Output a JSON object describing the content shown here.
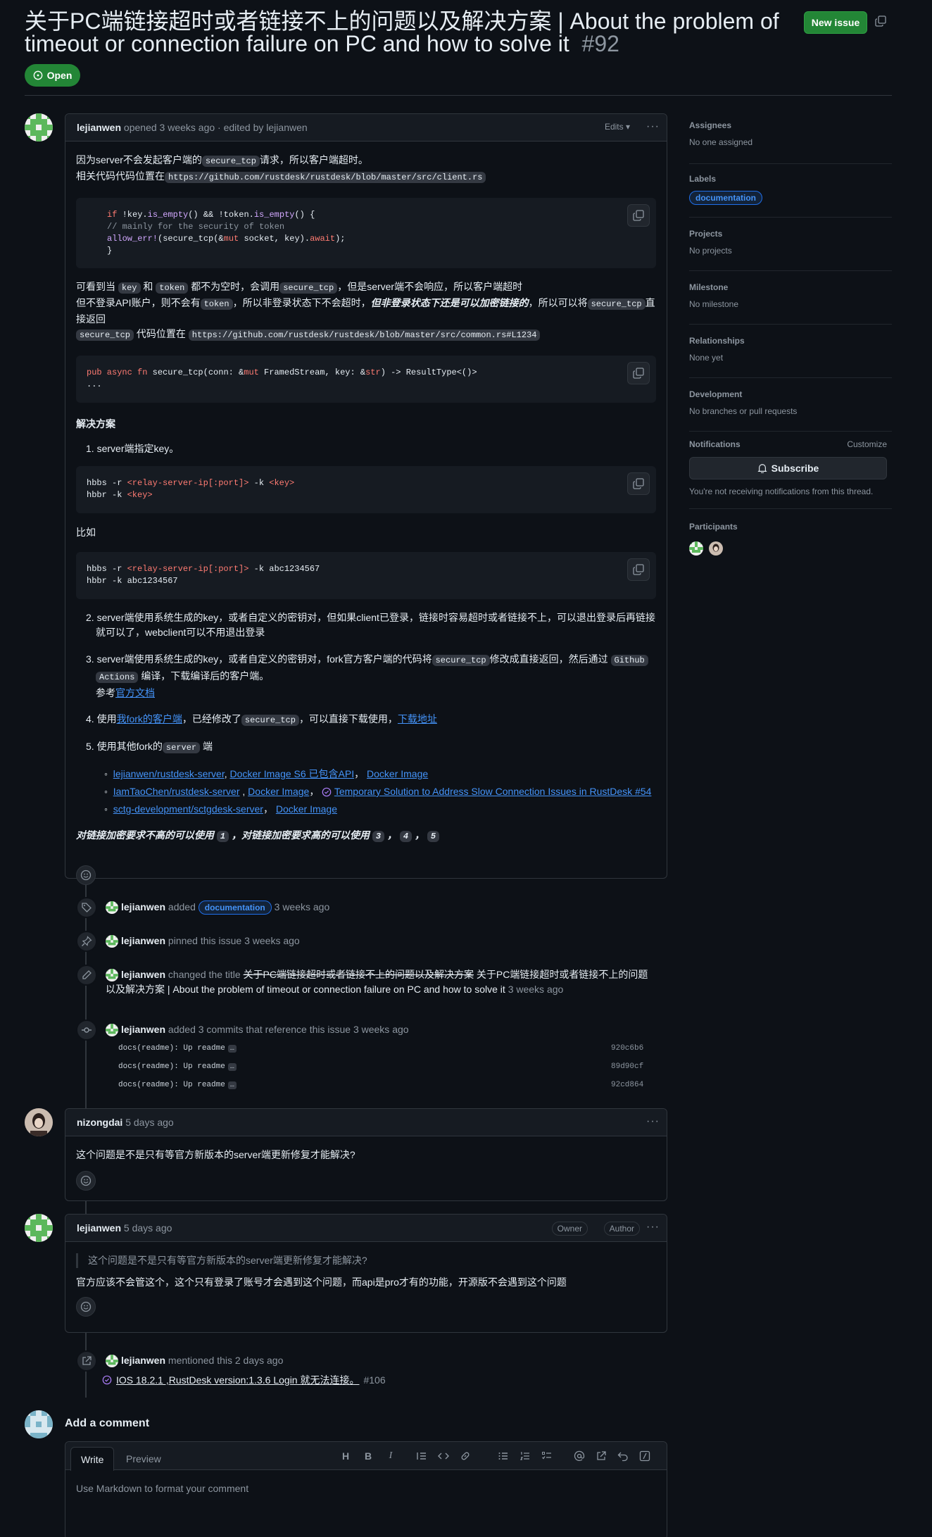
{
  "issue": {
    "title": "关于PC端链接超时或者链接不上的问题以及解决方案 | About the problem of timeout or connection failure on PC and how to solve it",
    "number": "#92",
    "new_issue_label": "New issue",
    "state": "Open"
  },
  "op": {
    "author": "lejianwen",
    "meta": "opened 3 weeks ago · edited by lejianwen",
    "edits_label": "Edits",
    "line1": "因为server不会发起客户端的",
    "line1_code": "secure_tcp",
    "line1_tail": "请求，所以客户端超时。",
    "line2": "相关代码代码位置在",
    "line2_code": "https://github.com/rustdesk/rustdesk/blob/master/src/client.rs",
    "code1": [
      "if !key.is_empty() && !token.is_empty() {",
      "// mainly for the security of token",
      "allow_err!(secure_tcp(&mut socket, key).await);",
      "}"
    ],
    "p2_a": "可看到当",
    "p2_key": "key",
    "p2_and": "和",
    "p2_token": "token",
    "p2_b": "都不为空时，会调用",
    "p2_secure": "secure_tcp",
    "p2_c": "，但是server端不会响应，所以客户端超时",
    "p3_a": "但不登录API账户，则不会有",
    "p3_token": "token",
    "p3_b": "，所以非登录状态下不会超时，",
    "p3_em": "但非登录状态下还是可以加密链接的",
    "p3_c": "，所以可以将",
    "p3_code": "secure_tcp",
    "p3_d": "直接返回",
    "p4_code": "secure_tcp",
    "p4_a": "代码位置在",
    "p4_url": "https://github.com/rustdesk/rustdesk/blob/master/src/common.rs#L1234",
    "code2": [
      "pub async fn secure_tcp(conn: &mut FramedStream, key: &str) -> ResultType<()>",
      "..."
    ],
    "solution_heading": "解决方案",
    "item1": "server端指定key。",
    "code3": [
      "hbbs -r <relay-server-ip[:port]> -k <key>",
      "hbbr -k <key>"
    ],
    "example_label": "比如",
    "code4": [
      "hbbs -r <relay-server-ip[:port]> -k abc1234567",
      "hbbr -k abc1234567"
    ],
    "item2_l1": "server端使用系统生成的key，或者自定义的密钥对，但如果client已登录，链接时容易超时或者链接不上，可以退出登录后再链接",
    "item2_l2": "就可以了，webclient可以不用退出登录",
    "item3_a": "server端使用系统生成的key，或者自定义的密钥对，fork官方客户端的代码将",
    "item3_code": "secure_tcp",
    "item3_b": "修改成直接返回，然后通过",
    "item3_code2": "Github",
    "item3_code3": "Actions",
    "item3_c": "编译，下载编译后的客户端。",
    "item3_ref": "参考",
    "item3_link": "官方文档",
    "item4_a": "使用",
    "item4_link": "我fork的客户端",
    "item4_b": "，已经修改了",
    "item4_code": "secure_tcp",
    "item4_c": "，可以直接下载使用，",
    "item4_link2": "下载地址",
    "item5_a": "使用其他fork的",
    "item5_code": "server",
    "item5_b": "端",
    "sub1_a": "lejianwen/rustdesk-server",
    "sub1_b": "Docker Image S6 已包含API",
    "sub1_c": "Docker Image",
    "sub2_a": "IamTaoChen/rustdesk-server",
    "sub2_b": "Docker Image",
    "sub2_c": "Temporary Solution to Address Slow Connection Issues in RustDesk #54",
    "sub3_a": "sctg-development/sctgdesk-server",
    "sub3_b": "Docker Image",
    "final_a": "对链接加密要求不高的可以使用",
    "final_1": "1",
    "final_b": "，对链接加密要求高的可以使用",
    "final_3": "3",
    "final_4": "4",
    "final_5": "5",
    "sep": "，"
  },
  "events": [
    {
      "user": "lejianwen",
      "action": "added",
      "label": "documentation",
      "time": "3 weeks ago"
    },
    {
      "user": "lejianwen",
      "action": "pinned this issue",
      "time": "3 weeks ago"
    },
    {
      "user": "lejianwen",
      "action": "changed the title",
      "old": "关于PC端链接超时或者链接不上的问题以及解决方案",
      "new1": "关于PC端链接超时或者链接不上的问题",
      "new2": "以及解决方案 | About the problem of timeout or connection failure on PC and how to solve it",
      "time": "3 weeks ago"
    },
    {
      "user": "lejianwen",
      "action": "added 3 commits that reference this issue",
      "time": "3 weeks ago"
    }
  ],
  "commits": [
    {
      "msg": "docs(readme): Up readme",
      "sha": "920c6b6"
    },
    {
      "msg": "docs(readme): Up readme",
      "sha": "89d90cf"
    },
    {
      "msg": "docs(readme): Up readme",
      "sha": "92cd864"
    }
  ],
  "comment1": {
    "author": "nizongdai",
    "time": "5 days ago",
    "body": "这个问题是不是只有等官方新版本的server端更新修复才能解决?"
  },
  "comment2": {
    "author": "lejianwen",
    "time": "5 days ago",
    "owner": "Owner",
    "author_badge": "Author",
    "quote": "这个问题是不是只有等官方新版本的server端更新修复才能解决?",
    "body": "官方应该不会管这个，这个只有登录了账号才会遇到这个问题，而api是pro才有的功能，开源版不会遇到这个问题"
  },
  "mention": {
    "user": "lejianwen",
    "action": "mentioned this",
    "time": "2 days ago",
    "ref_title": "IOS 18.2.1 ,RustDesk version:1.3.6 Login 就无法连接。",
    "ref_num": "#106"
  },
  "composer": {
    "heading": "Add a comment",
    "tab_write": "Write",
    "tab_preview": "Preview",
    "placeholder": "Use Markdown to format your comment"
  },
  "sidebar": {
    "assignees_h": "Assignees",
    "assignees_v": "No one assigned",
    "labels_h": "Labels",
    "label": "documentation",
    "projects_h": "Projects",
    "projects_v": "No projects",
    "milestone_h": "Milestone",
    "milestone_v": "No milestone",
    "relationships_h": "Relationships",
    "relationships_v": "None yet",
    "development_h": "Development",
    "development_v": "No branches or pull requests",
    "notifications_h": "Notifications",
    "customize": "Customize",
    "subscribe": "Subscribe",
    "notif_note": "You're not receiving notifications from this thread.",
    "participants_h": "Participants"
  },
  "colors": {
    "accent": "#4493f8",
    "open": "#238636",
    "bg": "#0d1117"
  }
}
